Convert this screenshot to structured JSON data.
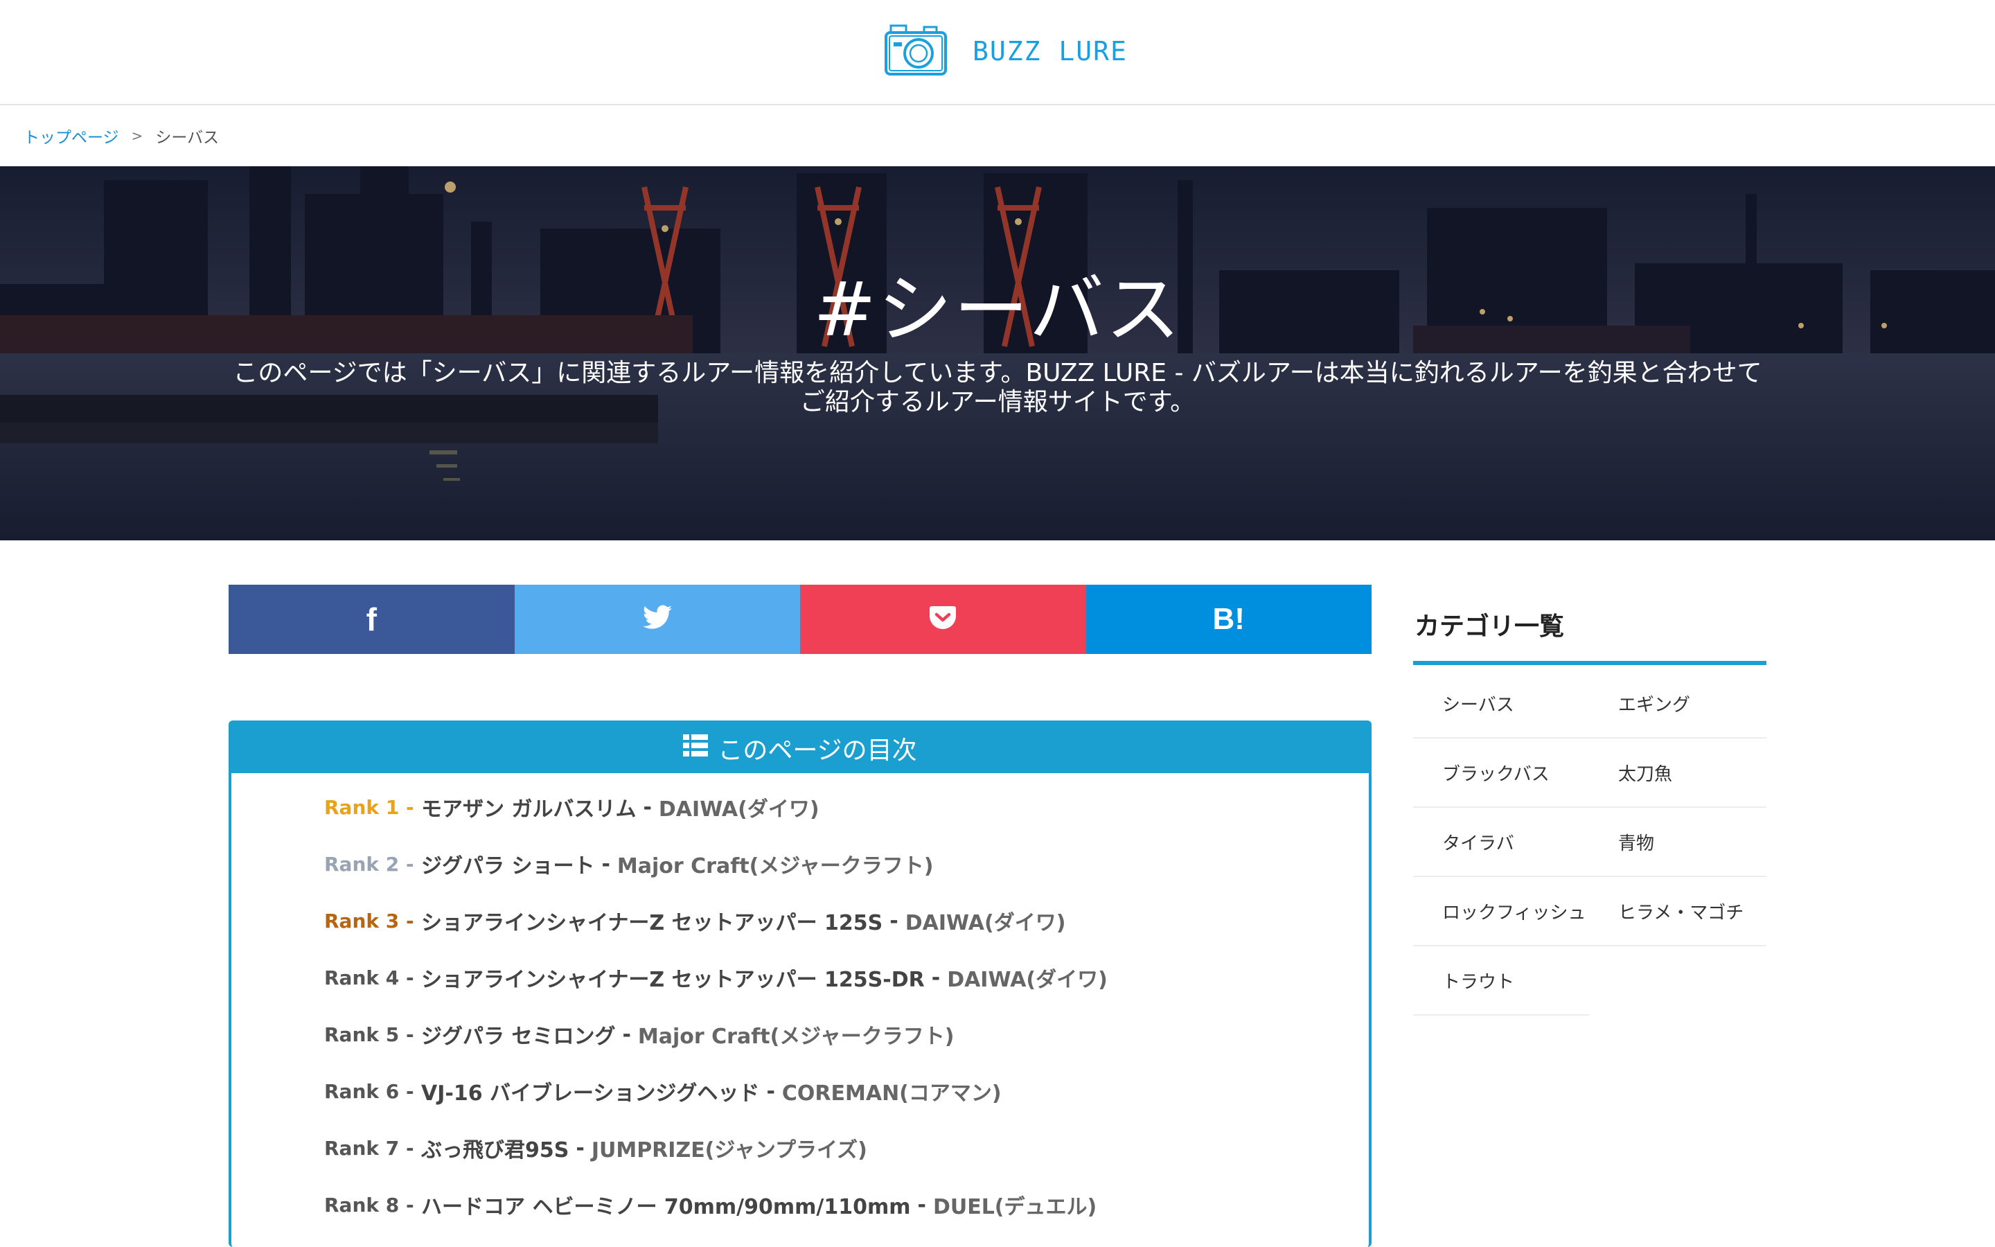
{
  "header": {
    "logo_text": "BUZZ LURE",
    "logo_icon": "camera-icon"
  },
  "breadcrumb": {
    "home": "トップページ",
    "separator": ">",
    "current": "シーバス"
  },
  "hero": {
    "title": "#シーバス",
    "description_line1": "このページでは「シーバス」に関連するルアー情報を紹介しています。BUZZ LURE - バズルアーは本当に釣れるルアーを釣果と合わせて",
    "description_line2": "ご紹介するルアー情報サイトです。"
  },
  "share": {
    "facebook": "f",
    "twitter_icon": "twitter-bird-icon",
    "pocket_icon": "pocket-icon",
    "hatena": "B!",
    "colors": {
      "facebook": "#3b5998",
      "twitter": "#55acee",
      "pocket": "#ef4056",
      "hatena": "#008fde"
    }
  },
  "toc": {
    "title": "このページの目次",
    "icon": "list-icon",
    "items": [
      {
        "rank": "Rank 1 -",
        "name": "モアザン ガルバスリム",
        "sep": "-",
        "maker": "DAIWA(ダイワ)"
      },
      {
        "rank": "Rank 2 -",
        "name": "ジグパラ ショート",
        "sep": "-",
        "maker": "Major Craft(メジャークラフト)"
      },
      {
        "rank": "Rank 3 -",
        "name": "ショアラインシャイナーZ セットアッパー 125S",
        "sep": "-",
        "maker": "DAIWA(ダイワ)"
      },
      {
        "rank": "Rank 4 -",
        "name": "ショアラインシャイナーZ セットアッパー 125S-DR",
        "sep": "-",
        "maker": "DAIWA(ダイワ)"
      },
      {
        "rank": "Rank 5 -",
        "name": "ジグパラ セミロング",
        "sep": "-",
        "maker": "Major Craft(メジャークラフト)"
      },
      {
        "rank": "Rank 6 -",
        "name": "VJ-16 バイブレーションジグヘッド",
        "sep": "-",
        "maker": "COREMAN(コアマン)"
      },
      {
        "rank": "Rank 7 -",
        "name": "ぶっ飛び君95S",
        "sep": "-",
        "maker": "JUMPRIZE(ジャンプライズ)"
      },
      {
        "rank": "Rank 8 -",
        "name": "ハードコア ヘビーミノー 70mm/90mm/110mm",
        "sep": "-",
        "maker": "DUEL(デュエル)"
      }
    ]
  },
  "sidebar": {
    "title": "カテゴリ一覧",
    "categories": [
      "シーバス",
      "エギング",
      "ブラックバス",
      "太刀魚",
      "タイラバ",
      "青物",
      "ロックフィッシュ",
      "ヒラメ・マゴチ",
      "トラウト"
    ]
  }
}
